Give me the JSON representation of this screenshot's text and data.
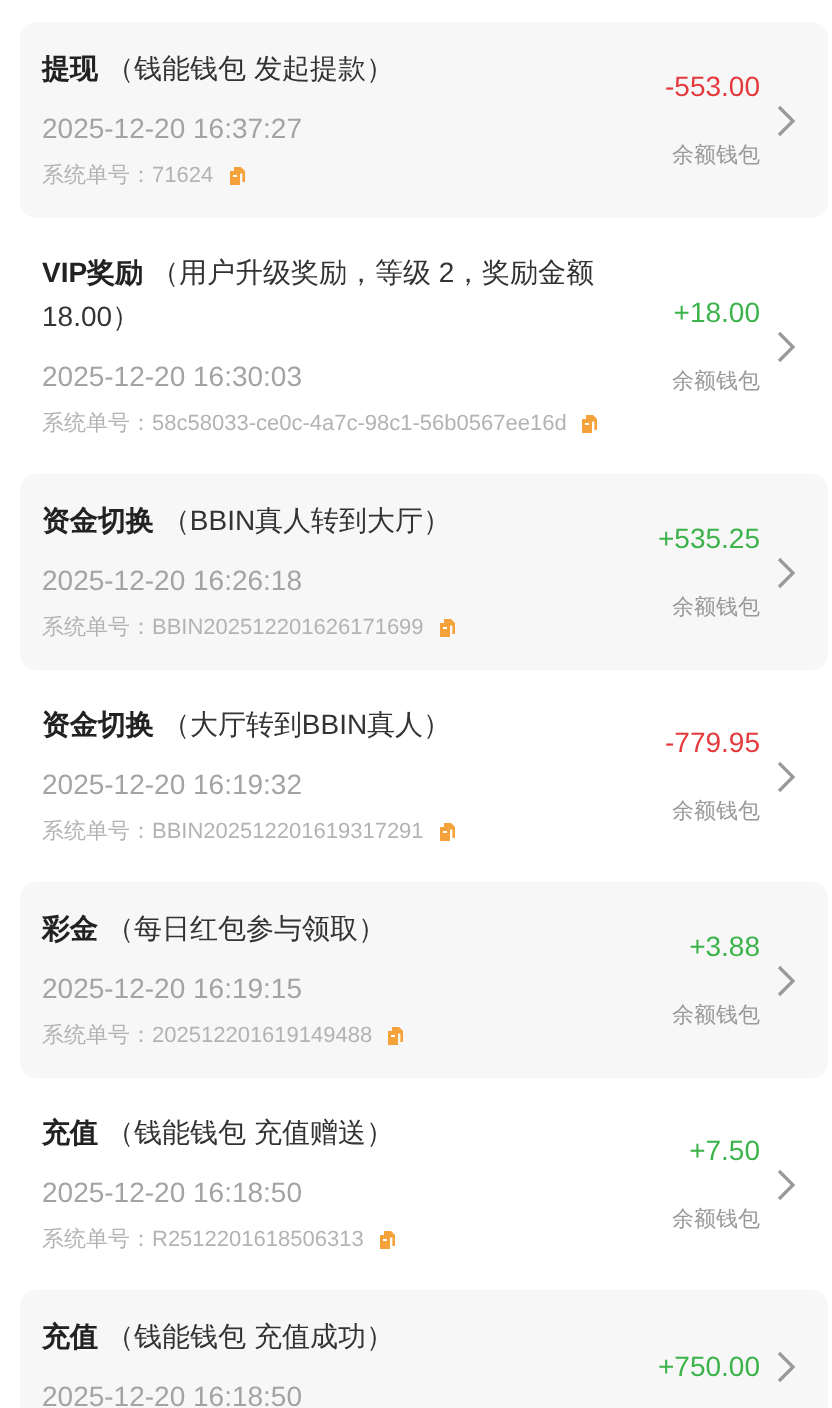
{
  "records": [
    {
      "type": "提现",
      "note": "（钱能钱包 发起提款）",
      "time": "2025-12-20 16:37:27",
      "order_label": "系统单号：",
      "order_no": "71624",
      "amount": "-553.00",
      "color": "#e4393c",
      "wallet": "余额钱包"
    },
    {
      "type": "VIP奖励",
      "note": "（用户升级奖励，等级 2，奖励金额 18.00）",
      "time": "2025-12-20 16:30:03",
      "order_label": "系统单号：",
      "order_no": "58c58033-ce0c-4a7c-98c1-56b0567ee16d",
      "amount": "+18.00",
      "color": "#3bb34a",
      "wallet": "余额钱包"
    },
    {
      "type": "资金切换",
      "note": "（BBIN真人转到大厅）",
      "time": "2025-12-20 16:26:18",
      "order_label": "系统单号：",
      "order_no": "BBIN202512201626171699",
      "amount": "+535.25",
      "color": "#3bb34a",
      "wallet": "余额钱包"
    },
    {
      "type": "资金切换",
      "note": "（大厅转到BBIN真人）",
      "time": "2025-12-20 16:19:32",
      "order_label": "系统单号：",
      "order_no": "BBIN202512201619317291",
      "amount": "-779.95",
      "color": "#e4393c",
      "wallet": "余额钱包"
    },
    {
      "type": "彩金",
      "note": "（每日红包参与领取）",
      "time": "2025-12-20 16:19:15",
      "order_label": "系统单号：",
      "order_no": "202512201619149488",
      "amount": "+3.88",
      "color": "#3bb34a",
      "wallet": "余额钱包"
    },
    {
      "type": "充值",
      "note": "（钱能钱包 充值赠送）",
      "time": "2025-12-20 16:18:50",
      "order_label": "系统单号：",
      "order_no": "R2512201618506313",
      "amount": "+7.50",
      "color": "#3bb34a",
      "wallet": "余额钱包"
    },
    {
      "type": "充值",
      "note": "（钱能钱包 充值成功）",
      "time": "2025-12-20 16:18:50",
      "amount": "+750.00",
      "color": "#3bb34a"
    }
  ]
}
